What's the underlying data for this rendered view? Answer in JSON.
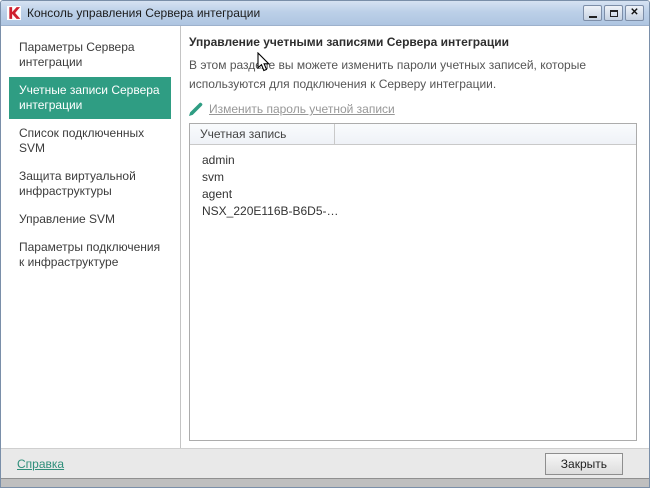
{
  "window": {
    "title": "Консоль управления Сервера интеграции",
    "controls": {
      "close_glyph": "✕"
    },
    "app_icon": "kaspersky-k-icon"
  },
  "sidebar": {
    "items": [
      {
        "label": "Параметры Сервера интеграции",
        "selected": false
      },
      {
        "label": "Учетные записи Сервера интеграции",
        "selected": true
      },
      {
        "label": "Список подключенных SVM",
        "selected": false
      },
      {
        "label": "Защита виртуальной инфраструктуры",
        "selected": false
      },
      {
        "label": "Управление SVM",
        "selected": false
      },
      {
        "label": "Параметры подключения к инфраструктуре",
        "selected": false
      }
    ]
  },
  "main": {
    "heading": "Управление учетными записями Сервера интеграции",
    "description": "В этом разделе вы можете изменить пароли учетных записей, которые используются для подключения к Серверу интеграции.",
    "change_password_link": "Изменить пароль учетной записи",
    "edit_icon": "pencil-icon",
    "table": {
      "columns": [
        "Учетная запись",
        ""
      ],
      "rows": [
        "admin",
        "svm",
        "agent",
        "NSX_220E116B-B6D5-…"
      ]
    }
  },
  "footer": {
    "help_link": "Справка",
    "close_button": "Закрыть"
  },
  "colors": {
    "accent_green": "#2f9d83",
    "titlebar_blue": "#bcd0e8",
    "footer_gray": "#e9e9e9"
  }
}
